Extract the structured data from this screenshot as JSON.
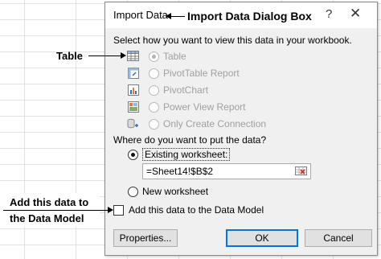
{
  "dialog": {
    "title": "Import Data",
    "help_glyph": "?",
    "close_glyph": "✕",
    "view_prompt": "Select how you want to view this data in your workbook.",
    "view_options": [
      {
        "label": "Table",
        "icon": "table-icon",
        "checked": true,
        "enabled": false
      },
      {
        "label": "PivotTable Report",
        "icon": "pivottable-icon",
        "checked": false,
        "enabled": false
      },
      {
        "label": "PivotChart",
        "icon": "pivotchart-icon",
        "checked": false,
        "enabled": false
      },
      {
        "label": "Power View Report",
        "icon": "powerview-icon",
        "checked": false,
        "enabled": false
      },
      {
        "label": "Only Create Connection",
        "icon": "connection-icon",
        "checked": false,
        "enabled": false
      }
    ],
    "put_prompt": "Where do you want to put the data?",
    "put_options": [
      {
        "label": "Existing worksheet:",
        "checked": true
      },
      {
        "label": "New worksheet",
        "checked": false
      }
    ],
    "location_value": "=Sheet14!$B$2",
    "data_model_label": "Add this data to the Data Model",
    "data_model_checked": false,
    "properties_button": "Properties...",
    "ok_button": "OK",
    "cancel_button": "Cancel"
  },
  "annotations": {
    "dialog_box": "Import Data Dialog Box",
    "table": "Table",
    "data_model_line1": "Add this data to",
    "data_model_line2": "the Data Model"
  },
  "colors": {
    "dialog_bg": "#f0f0f0",
    "disabled_text": "#a0a0a0",
    "primary_border": "#0078d7"
  }
}
